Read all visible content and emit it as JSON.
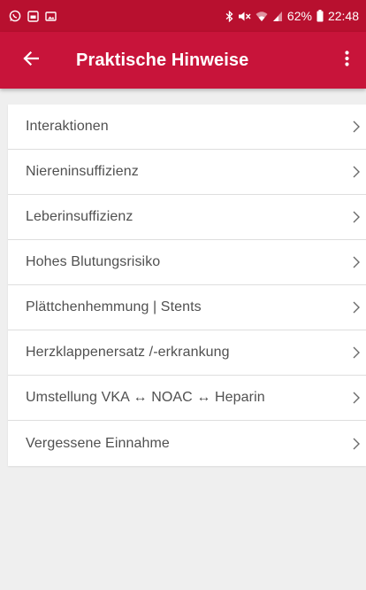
{
  "status_bar": {
    "battery_percent": "62%",
    "time": "22:48",
    "icons": [
      "whatsapp-icon",
      "message-icon",
      "gallery-icon",
      "bluetooth-icon",
      "mute-icon",
      "wifi-icon",
      "signal-icon",
      "battery-icon"
    ]
  },
  "app_bar": {
    "title": "Praktische Hinweise",
    "back_icon": "arrow-back-icon",
    "menu_icon": "more-vert-icon"
  },
  "list": {
    "items": [
      {
        "label": "Interaktionen"
      },
      {
        "label": "Niereninsuffizienz"
      },
      {
        "label": "Leberinsuffizienz"
      },
      {
        "label": "Hohes Blutungsrisiko"
      },
      {
        "label": "Plättchenhemmung | Stents"
      },
      {
        "label": "Herzklappenersatz /-erkrankung"
      },
      {
        "label": "Umstellung VKA ↔ NOAC ↔ Heparin"
      },
      {
        "label": "Vergessene Einnahme"
      }
    ],
    "chevron_icon": "chevron-right-icon"
  },
  "colors": {
    "status_bar": "#b8102f",
    "app_bar": "#c8143a",
    "background": "#efefef",
    "item_text": "#505050",
    "divider": "#dedede"
  }
}
